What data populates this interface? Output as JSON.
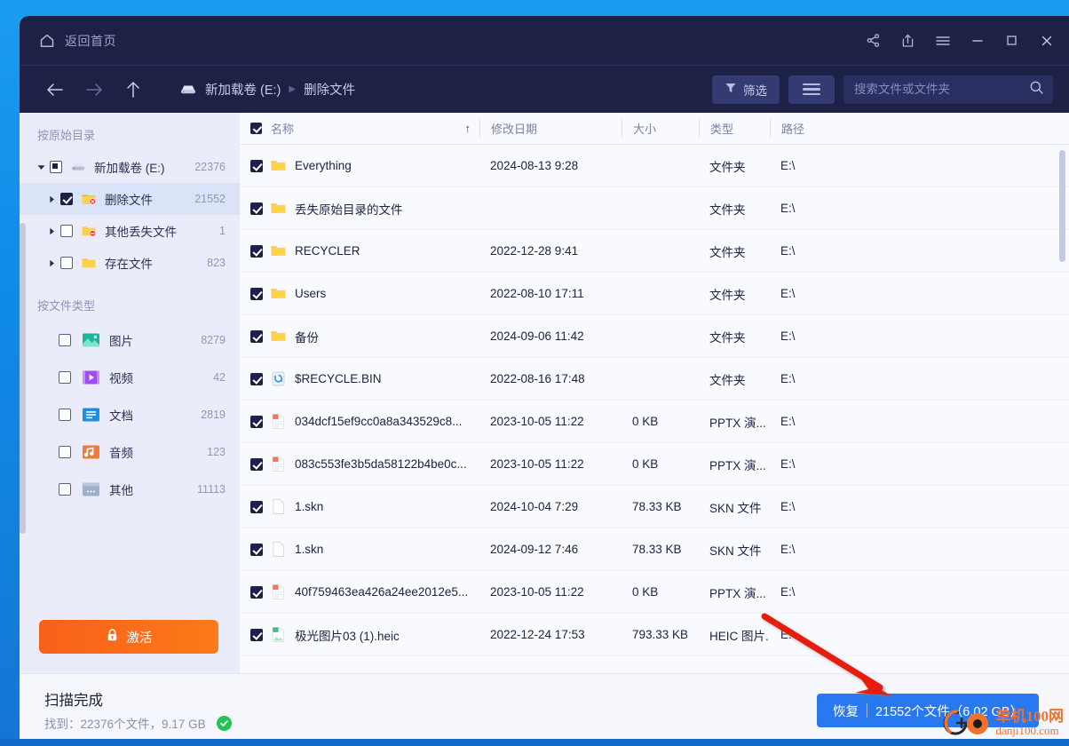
{
  "titlebar": {
    "home_label": "返回首页",
    "home_icon": "home-icon",
    "buttons": [
      {
        "name": "share-icon",
        "label": "分享"
      },
      {
        "name": "export-icon",
        "label": "导出"
      },
      {
        "name": "menu-icon",
        "label": "菜单"
      },
      {
        "name": "minimize-icon",
        "label": "最小化"
      },
      {
        "name": "maximize-icon",
        "label": "最大化"
      },
      {
        "name": "close-icon",
        "label": "关闭"
      }
    ]
  },
  "toolbar": {
    "back_icon": "arrow-left-icon",
    "forward_icon": "arrow-right-icon",
    "up_icon": "arrow-up-icon",
    "breadcrumb": [
      "新加载卷 (E:)",
      "删除文件"
    ],
    "filter_label": "筛选",
    "filter_icon": "funnel-icon",
    "listview_icon": "list-view-icon",
    "search_placeholder": "搜索文件或文件夹",
    "search_value": "",
    "search_icon": "search-icon"
  },
  "sidebar": {
    "section_dir_title": "按原始目录",
    "tree": [
      {
        "label": "新加载卷 (E:)",
        "count": "22376",
        "icon": "drive-icon",
        "check": "partial",
        "twisty": "down",
        "indent": 0,
        "selected": false
      },
      {
        "label": "删除文件",
        "count": "21552",
        "icon": "folder-deleted-icon",
        "check": "checked",
        "twisty": "right",
        "indent": 1,
        "selected": true
      },
      {
        "label": "其他丢失文件",
        "count": "1",
        "icon": "folder-lost-icon",
        "check": "unchecked",
        "twisty": "right",
        "indent": 1,
        "selected": false
      },
      {
        "label": "存在文件",
        "count": "823",
        "icon": "folder-icon",
        "check": "unchecked",
        "twisty": "right",
        "indent": 1,
        "selected": false
      }
    ],
    "section_type_title": "按文件类型",
    "types": [
      {
        "label": "图片",
        "count": "8279",
        "icon": "image-type-icon",
        "check": "unchecked"
      },
      {
        "label": "视频",
        "count": "42",
        "icon": "video-type-icon",
        "check": "unchecked"
      },
      {
        "label": "文档",
        "count": "2819",
        "icon": "document-type-icon",
        "check": "unchecked"
      },
      {
        "label": "音频",
        "count": "123",
        "icon": "audio-type-icon",
        "check": "unchecked"
      },
      {
        "label": "其他",
        "count": "11113",
        "icon": "other-type-icon",
        "check": "unchecked"
      }
    ],
    "activate_label": "激活",
    "activate_icon": "lock-icon"
  },
  "table": {
    "headers": {
      "name": "名称",
      "date": "修改日期",
      "size": "大小",
      "type": "类型",
      "path": "路径"
    },
    "sort_indicator": "↑",
    "header_checked": true,
    "rows": [
      {
        "checked": true,
        "icon": "folder-icon",
        "name": "Everything",
        "date": "2024-08-13 9:28",
        "size": "",
        "type": "文件夹",
        "path": "E:\\"
      },
      {
        "checked": true,
        "icon": "folder-icon",
        "name": "丢失原始目录的文件",
        "date": "",
        "size": "",
        "type": "文件夹",
        "path": "E:\\"
      },
      {
        "checked": true,
        "icon": "folder-icon",
        "name": "RECYCLER",
        "date": "2022-12-28 9:41",
        "size": "",
        "type": "文件夹",
        "path": "E:\\"
      },
      {
        "checked": true,
        "icon": "folder-icon",
        "name": "Users",
        "date": "2022-08-10 17:11",
        "size": "",
        "type": "文件夹",
        "path": "E:\\"
      },
      {
        "checked": true,
        "icon": "folder-icon",
        "name": "备份",
        "date": "2024-09-06 11:42",
        "size": "",
        "type": "文件夹",
        "path": "E:\\"
      },
      {
        "checked": true,
        "icon": "recycle-bin-icon",
        "name": "$RECYCLE.BIN",
        "date": "2022-08-16 17:48",
        "size": "",
        "type": "文件夹",
        "path": "E:\\"
      },
      {
        "checked": true,
        "icon": "pptx-file-icon",
        "name": "034dcf15ef9cc0a8a343529c8...",
        "date": "2023-10-05 11:22",
        "size": "0 KB",
        "type": "PPTX 演...",
        "path": "E:\\"
      },
      {
        "checked": true,
        "icon": "pptx-file-icon",
        "name": "083c553fe3b5da58122b4be0c...",
        "date": "2023-10-05 11:22",
        "size": "0 KB",
        "type": "PPTX 演...",
        "path": "E:\\"
      },
      {
        "checked": true,
        "icon": "blank-file-icon",
        "name": "1.skn",
        "date": "2024-10-04 7:29",
        "size": "78.33 KB",
        "type": "SKN 文件",
        "path": "E:\\"
      },
      {
        "checked": true,
        "icon": "blank-file-icon",
        "name": "1.skn",
        "date": "2024-09-12 7:46",
        "size": "78.33 KB",
        "type": "SKN 文件",
        "path": "E:\\"
      },
      {
        "checked": true,
        "icon": "pptx-file-icon",
        "name": "40f759463ea426a24ee2012e5...",
        "date": "2023-10-05 11:22",
        "size": "0 KB",
        "type": "PPTX 演...",
        "path": "E:\\"
      },
      {
        "checked": true,
        "icon": "heic-file-icon",
        "name": "极光图片03 (1).heic",
        "date": "2022-12-24 17:53",
        "size": "793.33 KB",
        "type": "HEIC 图片...",
        "path": "E:\\"
      }
    ]
  },
  "footer": {
    "scan_title": "扫描完成",
    "scan_summary": "找到：22376个文件，9.17 GB",
    "status_icon": "check-circle-icon",
    "recover_label": "恢复",
    "recover_detail": "21552个文件（6.02 GB）"
  },
  "watermark": {
    "cn": "单机100网",
    "en": "danji100.com"
  },
  "colors": {
    "titlebar": "#1d2146",
    "accent_blue": "#2878ef",
    "activate_orange": "#f7601a",
    "success_green": "#27c255",
    "selection": "#dbe3f8",
    "annotation_red": "#e81d0f"
  }
}
